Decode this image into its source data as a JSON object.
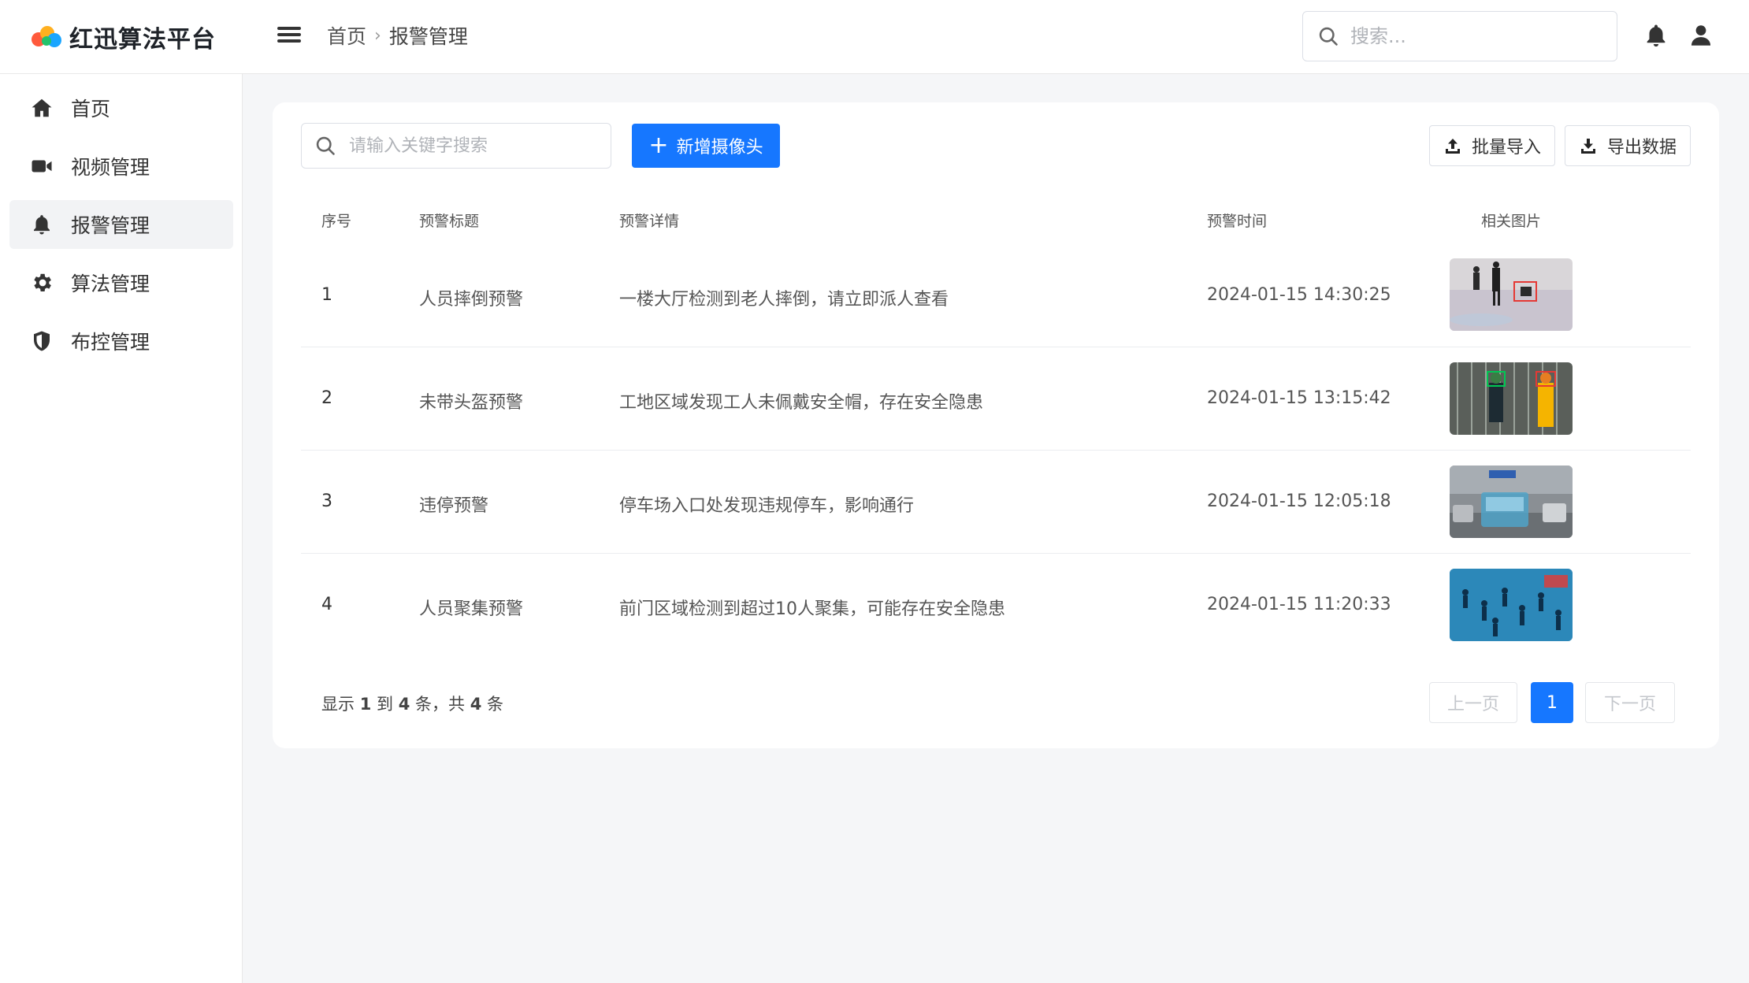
{
  "app": {
    "title": "红迅算法平台"
  },
  "header": {
    "breadcrumb": [
      "首页",
      "报警管理"
    ],
    "search_placeholder": "搜索..."
  },
  "sidebar": {
    "items": [
      {
        "label": "首页",
        "icon": "home-icon",
        "active": false
      },
      {
        "label": "视频管理",
        "icon": "video-camera-icon",
        "active": false
      },
      {
        "label": "报警管理",
        "icon": "bell-icon",
        "active": true
      },
      {
        "label": "算法管理",
        "icon": "gear-icon",
        "active": false
      },
      {
        "label": "布控管理",
        "icon": "shield-icon",
        "active": false
      }
    ]
  },
  "toolbar": {
    "search_placeholder": "请输入关键字搜索",
    "add_label": "新增摄像头",
    "import_label": "批量导入",
    "export_label": "导出数据"
  },
  "table": {
    "columns": [
      "序号",
      "预警标题",
      "预警详情",
      "预警时间",
      "相关图片"
    ],
    "rows": [
      {
        "index": "1",
        "title": "人员摔倒预警",
        "detail": "一楼大厅检测到老人摔倒，请立即派人查看",
        "time": "2024-01-15 14:30:25"
      },
      {
        "index": "2",
        "title": "未带头盔预警",
        "detail": "工地区域发现工人未佩戴安全帽，存在安全隐患",
        "time": "2024-01-15 13:15:42"
      },
      {
        "index": "3",
        "title": "违停预警",
        "detail": "停车场入口处发现违规停车，影响通行",
        "time": "2024-01-15 12:05:18"
      },
      {
        "index": "4",
        "title": "人员聚集预警",
        "detail": "前门区域检测到超过10人聚集，可能存在安全隐患",
        "time": "2024-01-15 11:20:33"
      }
    ]
  },
  "pagination": {
    "summary_prefix": "显示",
    "from": "1",
    "to_word": "到",
    "to": "4",
    "total_prefix": "条，共",
    "total": "4",
    "suffix": "条",
    "prev_label": "上一页",
    "current_page": "1",
    "next_label": "下一页"
  },
  "colors": {
    "primary": "#1677ff",
    "border": "#dcdfe6",
    "background": "#f5f6f8"
  }
}
